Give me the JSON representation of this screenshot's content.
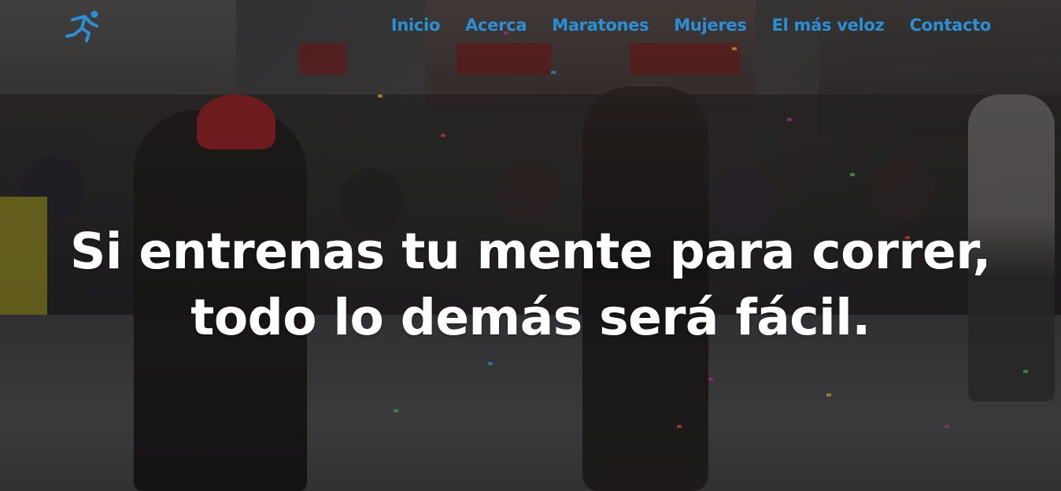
{
  "nav": {
    "items": [
      {
        "label": "Inicio"
      },
      {
        "label": "Acerca"
      },
      {
        "label": "Maratones"
      },
      {
        "label": "Mujeres"
      },
      {
        "label": "El más veloz"
      },
      {
        "label": "Contacto"
      }
    ]
  },
  "hero": {
    "line1": "Si entrenas tu mente para correr,",
    "line2": "todo lo demás será fácil."
  },
  "colors": {
    "nav_link": "#2b8fd6",
    "headline": "#ffffff"
  },
  "icons": {
    "logo": "runner-logo-icon"
  }
}
